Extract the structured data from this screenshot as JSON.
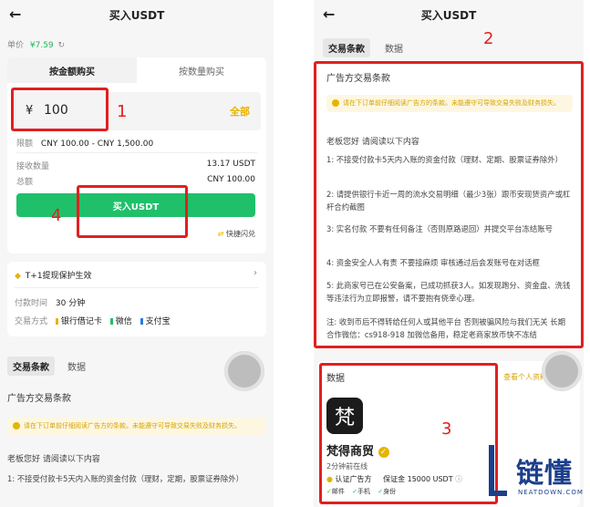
{
  "left": {
    "title": "买入USDT",
    "unit_price_label": "单价",
    "unit_price_value": "¥7.59",
    "tabs": [
      "按金额购买",
      "按数量购买"
    ],
    "amount_currency": "¥",
    "amount_value": "100",
    "all_label": "全部",
    "limit_label": "限额",
    "limit_value": "CNY 100.00 - CNY 1,500.00",
    "receive_label": "接收数量",
    "receive_value": "13.17 USDT",
    "total_label": "总额",
    "total_value": "CNY 100.00",
    "buy_button": "买入USDT",
    "quick_flash": "快捷闪兑",
    "protection": "T+1提现保护生效",
    "pay_time_label": "付款时间",
    "pay_time_value": "30 分钟",
    "pay_method_label": "交易方式",
    "pay_methods": [
      "银行借记卡",
      "微信",
      "支付宝"
    ],
    "bottom_tabs": [
      "交易条款",
      "数据"
    ],
    "terms_title": "广告方交易条款",
    "warning": "请在下订单前仔细阅读广告方的条款。未能遵守可导致交易失败及财务损失。",
    "terms_intro": "老板您好 请阅读以下内容",
    "term1": "1:  不接受付款卡5天内入账的资金付款（理财，定期，股票证券除外）"
  },
  "right": {
    "title": "买入USDT",
    "tabs": [
      "交易条款",
      "数据"
    ],
    "terms_title": "广告方交易条款",
    "warning": "请在下订单前仔细阅读广告方的条款。未能遵守可导致交易失败及财务损失。",
    "intro": "老板您好 请阅读以下内容",
    "terms": [
      "1:  不接受付款卡5天内入账的资金付款（理财、定期、股票证券除外）",
      "2:  请提供银行卡近一周的流水交易明细（最少3张）跟币安现货资产或杠杆合约截图",
      "3:  实名付款 不要有任何备注（否则原路退回）并提交平台冻结账号",
      "4:  资金安全人人有责 不要接麻烦 审核通过后会发账号在对话框",
      "5:  此商家号已在公安备案，已成功抓获3人。如发现跑分、资金盘、洗钱等违法行为立即报警，请不要抱有侥幸心理。",
      "注:  收到币后不得转给任何人或其他平台 否则被骗风险与我们无关 长期合作微信：cs918-918 加微信备用，稳定老商家放币快不冻结"
    ],
    "data_title": "数据",
    "see_more": "查看个人资料",
    "merchant_logo_char": "梵",
    "merchant_name": "梵得商贸",
    "online_status": "2分钟前在线",
    "verified_label": "认证广告方",
    "deposit_label": "保证金 15000 USDT",
    "badges": [
      "邮件",
      "手机",
      "身份"
    ]
  },
  "annotations": {
    "n1": "1",
    "n2": "2",
    "n3": "3",
    "n4": "4"
  },
  "watermark": {
    "brand": "链懂",
    "site": "NEATDOWN.COM"
  }
}
